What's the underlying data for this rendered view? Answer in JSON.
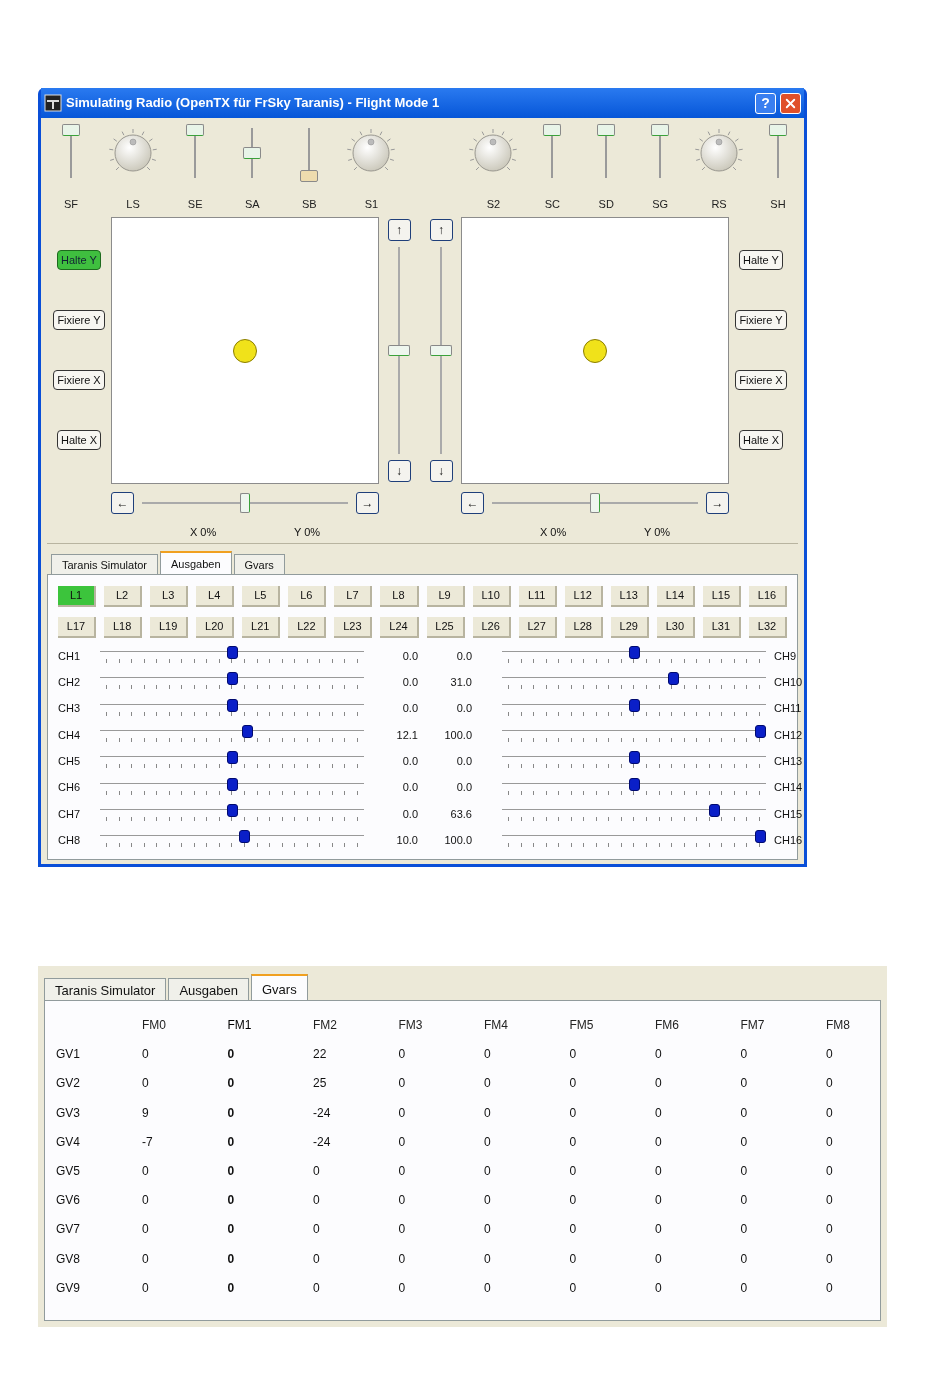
{
  "window": {
    "title": "Simulating Radio (OpenTX für FrSky Taranis) - Flight Mode 1",
    "help_button": "?"
  },
  "top_controls": {
    "left": [
      {
        "kind": "slider",
        "label": "SF",
        "level": 1
      },
      {
        "kind": "knob",
        "label": "LS"
      },
      {
        "kind": "slider",
        "label": "SE",
        "level": 1
      },
      {
        "kind": "slider",
        "label": "SA",
        "level": 0.5
      },
      {
        "kind": "slider",
        "label": "SB",
        "level": 0
      },
      {
        "kind": "knob",
        "label": "S1"
      }
    ],
    "right": [
      {
        "kind": "knob",
        "label": "S2"
      },
      {
        "kind": "slider",
        "label": "SC",
        "level": 1
      },
      {
        "kind": "slider",
        "label": "SD",
        "level": 1
      },
      {
        "kind": "slider",
        "label": "SG",
        "level": 1
      },
      {
        "kind": "knob",
        "label": "RS"
      },
      {
        "kind": "slider",
        "label": "SH",
        "level": 1
      }
    ]
  },
  "sticks": [
    {
      "buttons": [
        {
          "label": "Halte Y",
          "on": true
        },
        {
          "label": "Fixiere Y",
          "on": false
        },
        {
          "label": "Fixiere X",
          "on": false
        },
        {
          "label": "Halte X",
          "on": false
        }
      ],
      "left_button": "←",
      "right_button": "→",
      "h_slider": {
        "level": 0.5
      },
      "x_reading": "X 0%",
      "y_reading": "Y 0%"
    },
    {
      "buttons": [
        {
          "label": "Halte Y",
          "on": false
        },
        {
          "label": "Fixiere Y",
          "on": false
        },
        {
          "label": "Fixiere X",
          "on": false
        },
        {
          "label": "Halte X",
          "on": false
        }
      ],
      "left_button": "←",
      "right_button": "→",
      "h_slider": {
        "level": 0.5
      },
      "x_reading": "X 0%",
      "y_reading": "Y 0%"
    }
  ],
  "center_sliders": [
    {
      "up_button": "↑",
      "down_button": "↓",
      "level": 0.5
    },
    {
      "up_button": "↑",
      "down_button": "↓",
      "level": 0.5
    }
  ],
  "tabs": [
    {
      "label": "Taranis Simulator",
      "selected": false
    },
    {
      "label": "Ausgaben",
      "selected": true
    },
    {
      "label": "Gvars",
      "selected": false
    }
  ],
  "logical_switches": [
    {
      "label": "L1",
      "on": true
    },
    {
      "label": "L2",
      "on": false
    },
    {
      "label": "L3",
      "on": false
    },
    {
      "label": "L4",
      "on": false
    },
    {
      "label": "L5",
      "on": false
    },
    {
      "label": "L6",
      "on": false
    },
    {
      "label": "L7",
      "on": false
    },
    {
      "label": "L8",
      "on": false
    },
    {
      "label": "L9",
      "on": false
    },
    {
      "label": "L10",
      "on": false
    },
    {
      "label": "L11",
      "on": false
    },
    {
      "label": "L12",
      "on": false
    },
    {
      "label": "L13",
      "on": false
    },
    {
      "label": "L14",
      "on": false
    },
    {
      "label": "L15",
      "on": false
    },
    {
      "label": "L16",
      "on": false
    },
    {
      "label": "L17",
      "on": false
    },
    {
      "label": "L18",
      "on": false
    },
    {
      "label": "L19",
      "on": false
    },
    {
      "label": "L20",
      "on": false
    },
    {
      "label": "L21",
      "on": false
    },
    {
      "label": "L22",
      "on": false
    },
    {
      "label": "L23",
      "on": false
    },
    {
      "label": "L24",
      "on": false
    },
    {
      "label": "L25",
      "on": false
    },
    {
      "label": "L26",
      "on": false
    },
    {
      "label": "L27",
      "on": false
    },
    {
      "label": "L28",
      "on": false
    },
    {
      "label": "L29",
      "on": false
    },
    {
      "label": "L30",
      "on": false
    },
    {
      "label": "L31",
      "on": false
    },
    {
      "label": "L32",
      "on": false
    }
  ],
  "channels_left": [
    {
      "label": "CH1",
      "level": 0.5,
      "reading": "0.0"
    },
    {
      "label": "CH2",
      "level": 0.5,
      "reading": "0.0"
    },
    {
      "label": "CH3",
      "level": 0.5,
      "reading": "0.0"
    },
    {
      "label": "CH4",
      "level": 0.56,
      "reading": "12.1"
    },
    {
      "label": "CH5",
      "level": 0.5,
      "reading": "0.0"
    },
    {
      "label": "CH6",
      "level": 0.5,
      "reading": "0.0"
    },
    {
      "label": "CH7",
      "level": 0.5,
      "reading": "0.0"
    },
    {
      "label": "CH8",
      "level": 0.55,
      "reading": "10.0"
    }
  ],
  "channels_right": [
    {
      "label": "CH9",
      "level": 0.5,
      "reading": "0.0"
    },
    {
      "label": "CH10",
      "level": 0.655,
      "reading": "31.0"
    },
    {
      "label": "CH11",
      "level": 0.5,
      "reading": "0.0"
    },
    {
      "label": "CH12",
      "level": 1,
      "reading": "100.0"
    },
    {
      "label": "CH13",
      "level": 0.5,
      "reading": "0.0"
    },
    {
      "label": "CH14",
      "level": 0.5,
      "reading": "0.0"
    },
    {
      "label": "CH15",
      "level": 0.818,
      "reading": "63.6"
    },
    {
      "label": "CH16",
      "level": 1,
      "reading": "100.0"
    }
  ],
  "gvars_panel": {
    "tabs": [
      {
        "label": "Taranis Simulator",
        "selected": false
      },
      {
        "label": "Ausgaben",
        "selected": false
      },
      {
        "label": "Gvars",
        "selected": true
      }
    ],
    "columns": [
      {
        "label": "FM0",
        "selected": false
      },
      {
        "label": "FM1",
        "selected": true
      },
      {
        "label": "FM2",
        "selected": false
      },
      {
        "label": "FM3",
        "selected": false
      },
      {
        "label": "FM4",
        "selected": false
      },
      {
        "label": "FM5",
        "selected": false
      },
      {
        "label": "FM6",
        "selected": false
      },
      {
        "label": "FM7",
        "selected": false
      },
      {
        "label": "FM8",
        "selected": false
      }
    ],
    "rows": [
      {
        "label": "GV1",
        "values": [
          "0",
          "0",
          "22",
          "0",
          "0",
          "0",
          "0",
          "0",
          "0"
        ]
      },
      {
        "label": "GV2",
        "values": [
          "0",
          "0",
          "25",
          "0",
          "0",
          "0",
          "0",
          "0",
          "0"
        ]
      },
      {
        "label": "GV3",
        "values": [
          "9",
          "0",
          "-24",
          "0",
          "0",
          "0",
          "0",
          "0",
          "0"
        ]
      },
      {
        "label": "GV4",
        "values": [
          "-7",
          "0",
          "-24",
          "0",
          "0",
          "0",
          "0",
          "0",
          "0"
        ]
      },
      {
        "label": "GV5",
        "values": [
          "0",
          "0",
          "0",
          "0",
          "0",
          "0",
          "0",
          "0",
          "0"
        ]
      },
      {
        "label": "GV6",
        "values": [
          "0",
          "0",
          "0",
          "0",
          "0",
          "0",
          "0",
          "0",
          "0"
        ]
      },
      {
        "label": "GV7",
        "values": [
          "0",
          "0",
          "0",
          "0",
          "0",
          "0",
          "0",
          "0",
          "0"
        ]
      },
      {
        "label": "GV8",
        "values": [
          "0",
          "0",
          "0",
          "0",
          "0",
          "0",
          "0",
          "0",
          "0"
        ]
      },
      {
        "label": "GV9",
        "values": [
          "0",
          "0",
          "0",
          "0",
          "0",
          "0",
          "0",
          "0",
          "0"
        ]
      }
    ]
  }
}
